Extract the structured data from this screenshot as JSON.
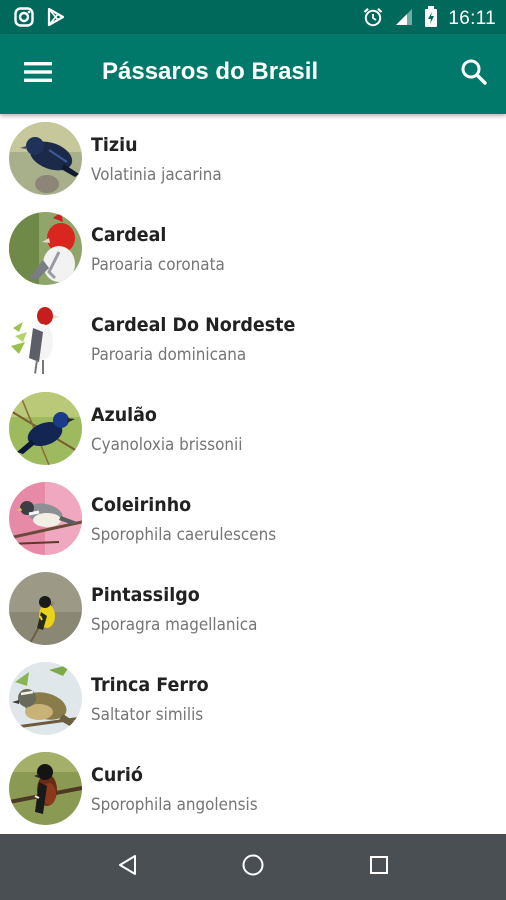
{
  "status_bar": {
    "time": "16:11",
    "left_icons": [
      "instagram-icon",
      "play-store-icon"
    ],
    "right_icons": [
      "alarm-icon",
      "signal-icon",
      "battery-icon"
    ]
  },
  "app_bar": {
    "title": "Pássaros do Brasil",
    "menu_icon": "menu-icon",
    "search_icon": "search-icon",
    "color": "#00796b",
    "status_color": "#00695c"
  },
  "birds": [
    {
      "name": "Tiziu",
      "scientific": "Volatinia jacarina"
    },
    {
      "name": "Cardeal",
      "scientific": "Paroaria coronata"
    },
    {
      "name": "Cardeal Do Nordeste",
      "scientific": "Paroaria dominicana"
    },
    {
      "name": "Azulão",
      "scientific": "Cyanoloxia brissonii"
    },
    {
      "name": "Coleirinho",
      "scientific": "Sporophila caerulescens"
    },
    {
      "name": "Pintassilgo",
      "scientific": "Sporagra magellanica"
    },
    {
      "name": "Trinca Ferro",
      "scientific": "Saltator similis"
    },
    {
      "name": "Curió",
      "scientific": "Sporophila angolensis"
    }
  ],
  "nav_bar": {
    "buttons": [
      "back-icon",
      "home-icon",
      "recents-icon"
    ],
    "color": "#4a4f54"
  }
}
